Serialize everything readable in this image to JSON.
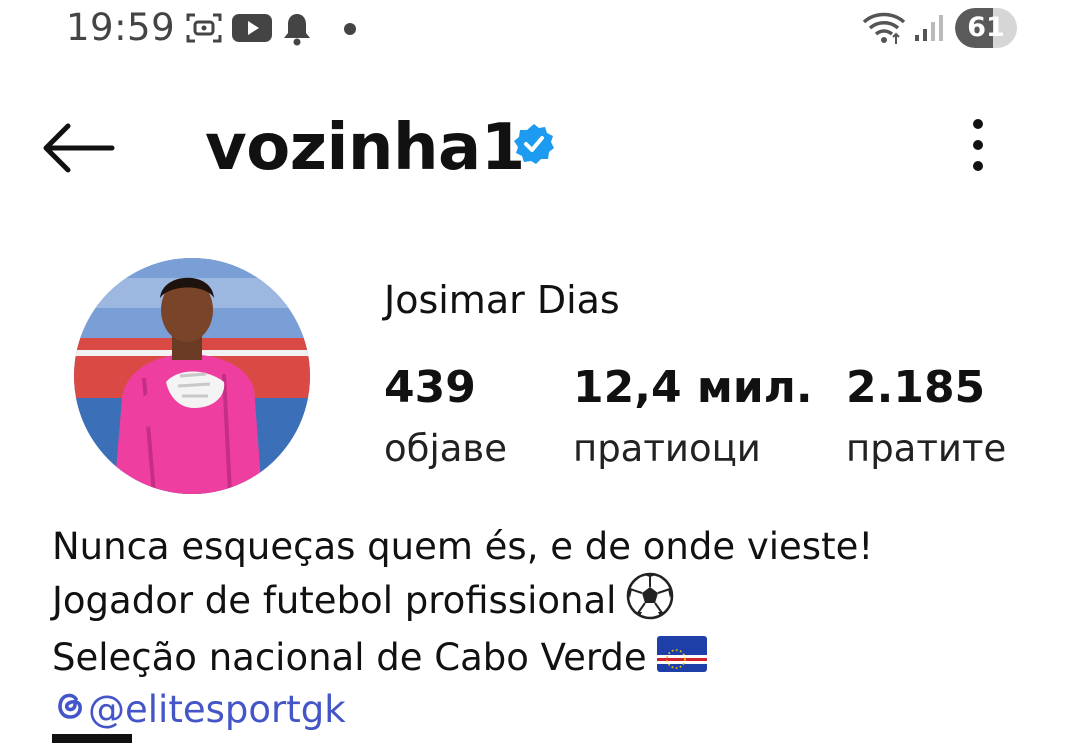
{
  "status_bar": {
    "time": "19:59",
    "battery_level": "61",
    "battery_fraction": 0.61,
    "icons": [
      "screen-record-icon",
      "youtube-icon",
      "bell-icon",
      "dot-icon",
      "wifi-icon",
      "signal-icon"
    ]
  },
  "header": {
    "username": "vozinha1",
    "verified": true,
    "icons": [
      "back-arrow-icon",
      "verified-badge-icon",
      "more-vertical-icon"
    ]
  },
  "profile": {
    "full_name": "Josimar Dias",
    "stats": {
      "posts": {
        "value": "439",
        "label": "објаве"
      },
      "followers": {
        "value": "12,4 мил.",
        "label": "пратиоци"
      },
      "following": {
        "value": "2.185",
        "label": "пратите"
      }
    }
  },
  "bio": {
    "line1": "Nunca esqueças quem és, e de onde vieste!",
    "line2": "Jogador de futebol profissional",
    "line2_emoji": "soccer-ball-icon",
    "line3": "Seleção nacional de Cabo Verde",
    "line3_emoji": "cape-verde-flag-icon",
    "link": "@elitesportgk",
    "link_icon": "threads-icon"
  },
  "colors": {
    "verified_blue": "#1d9bf0",
    "link_blue": "#4455c7",
    "text": "#111111",
    "status_grey": "#444444"
  }
}
